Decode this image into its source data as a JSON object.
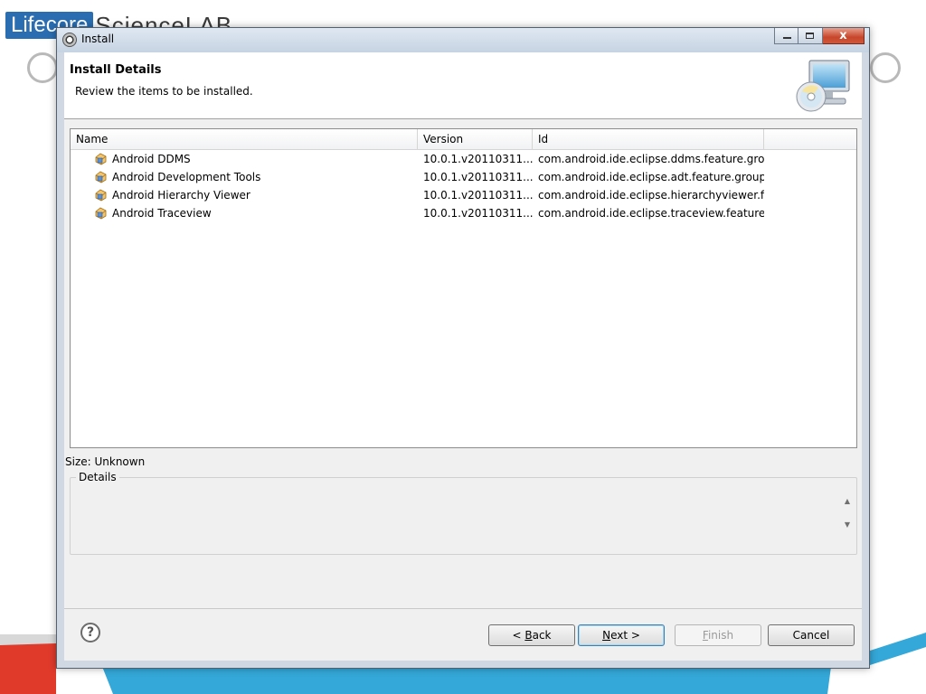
{
  "slide": {
    "logo_prefix": "Lifecore",
    "logo_rest": "ScienceLAB"
  },
  "window": {
    "title": "Install",
    "close_glyph": "x"
  },
  "header": {
    "title": "Install Details",
    "description": "Review the items to be installed."
  },
  "table": {
    "columns": [
      "Name",
      "Version",
      "Id"
    ],
    "rows": [
      {
        "name": "Android DDMS",
        "version": "10.0.1.v20110311...",
        "id": "com.android.ide.eclipse.ddms.feature.gro..."
      },
      {
        "name": "Android Development Tools",
        "version": "10.0.1.v20110311...",
        "id": "com.android.ide.eclipse.adt.feature.group"
      },
      {
        "name": "Android Hierarchy Viewer",
        "version": "10.0.1.v20110311...",
        "id": "com.android.ide.eclipse.hierarchyviewer.f..."
      },
      {
        "name": "Android Traceview",
        "version": "10.0.1.v20110311...",
        "id": "com.android.ide.eclipse.traceview.feature...."
      }
    ]
  },
  "size_label": "Size: Unknown",
  "details_label": "Details",
  "buttons": {
    "help": "?",
    "back_prefix": "< ",
    "back_mnemonic": "B",
    "back_rest": "ack",
    "next_mnemonic": "N",
    "next_rest": "ext >",
    "finish_mnemonic": "F",
    "finish_rest": "inish",
    "cancel": "Cancel"
  },
  "icons": {
    "window": "eclipse-gear-icon",
    "header": "computer-cd-icon",
    "feature": "feature-plugin-icon",
    "help": "help-icon"
  },
  "colors": {
    "logo_blue": "#2a6db0",
    "slide_red": "#e03a2b",
    "slide_cyan": "#34a8d8",
    "next_focus": "#3c7fb1"
  }
}
